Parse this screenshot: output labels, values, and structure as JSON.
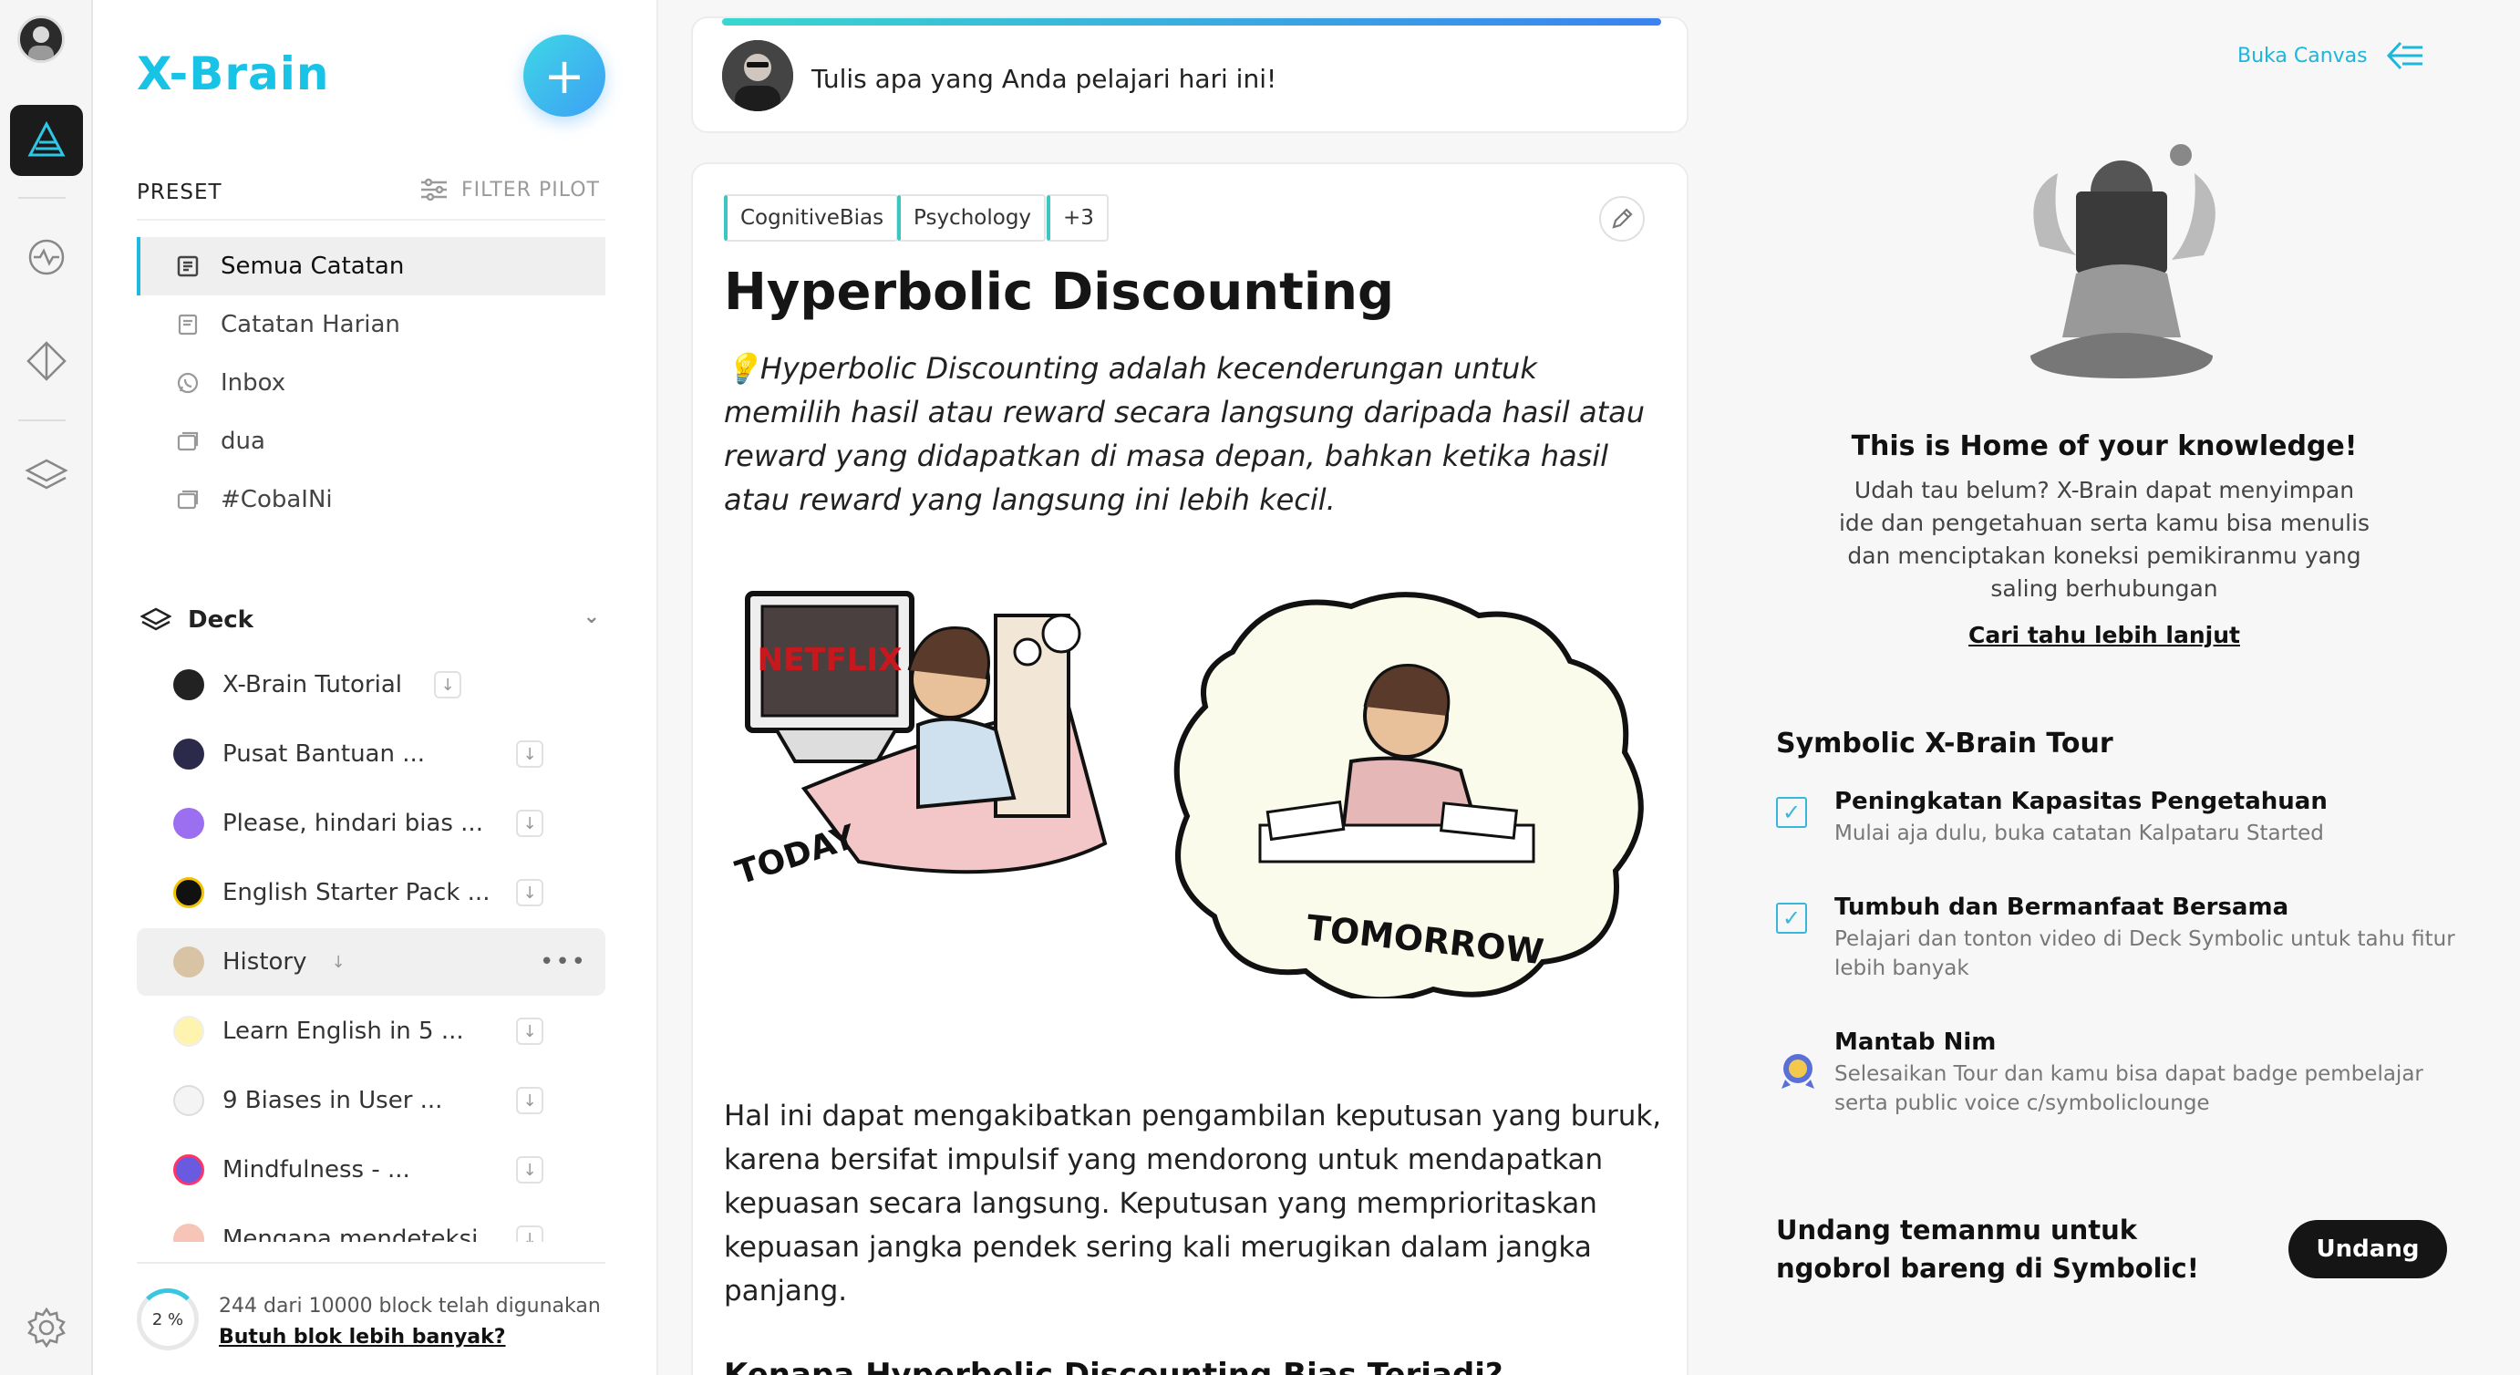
{
  "app": {
    "brand": "X-Brain"
  },
  "sidebar": {
    "preset_label": "PRESET",
    "filter_pilot": "FILTER PILOT",
    "nav": [
      {
        "label": "Semua Catatan",
        "icon": "notes-icon"
      },
      {
        "label": "Catatan Harian",
        "icon": "daily-notes-icon"
      },
      {
        "label": "Inbox",
        "icon": "whatsapp-icon"
      },
      {
        "label": "dua",
        "icon": "folder-icon"
      },
      {
        "label": "#CobaINi",
        "icon": "folder-icon"
      }
    ],
    "deck_label": "Deck",
    "decks": [
      {
        "label": "X-Brain Tutorial"
      },
      {
        "label": "Pusat Bantuan ..."
      },
      {
        "label": "Please, hindari bias ..."
      },
      {
        "label": "English Starter Pack ..."
      },
      {
        "label": "History"
      },
      {
        "label": "Learn English in 5 ..."
      },
      {
        "label": "9 Biases in User ..."
      },
      {
        "label": "Mindfulness - ..."
      },
      {
        "label": "Mengapa mendeteksi ..."
      }
    ],
    "usage": {
      "percent_label": "2 %",
      "percent": 2,
      "text": "244 dari 10000 block telah digunakan",
      "link": "Butuh blok lebih banyak?"
    }
  },
  "composer": {
    "placeholder": "Tulis apa yang Anda pelajari hari ini!"
  },
  "note": {
    "tags": [
      "CognitiveBias",
      "Psychology",
      "+3"
    ],
    "title": "Hyperbolic Discounting",
    "quote_emoji": "💡",
    "quote": "Hyperbolic Discounting adalah kecenderungan untuk memilih hasil atau reward secara langsung daripada hasil atau reward yang didapatkan di masa depan, bahkan ketika hasil atau reward yang langsung ini lebih kecil.",
    "illustration": {
      "tv_text": "NETFLIX",
      "left_caption": "TODAY",
      "right_caption": "TOMORROW"
    },
    "body": "Hal ini dapat mengakibatkan pengambilan keputusan yang buruk, karena bersifat impulsif yang mendorong untuk mendapatkan kepuasan secara langsung. Keputusan yang memprioritaskan kepuasan jangka pendek sering kali merugikan dalam jangka panjang.",
    "next_heading": "Kenapa Hyperbolic Discounting Bias Terjadi?"
  },
  "right": {
    "open_canvas": "Buka Canvas",
    "home_title": "This is Home of your knowledge!",
    "home_desc": "Udah tau belum? X-Brain dapat menyimpan ide dan pengetahuan serta kamu bisa menulis dan menciptakan koneksi pemikiranmu yang saling berhubungan",
    "home_link": "Cari tahu lebih lanjut",
    "tour_title": "Symbolic X-Brain Tour",
    "tour": [
      {
        "name": "Peningkatan Kapasitas Pengetahuan",
        "desc": "Mulai aja dulu, buka catatan Kalpataru Started",
        "done": true
      },
      {
        "name": "Tumbuh dan Bermanfaat Bersama",
        "desc": "Pelajari dan tonton video di Deck Symbolic untuk tahu fitur lebih banyak",
        "done": true
      },
      {
        "name": "Mantab Nim",
        "desc": "Selesaikan Tour dan kamu bisa dapat badge pembelajar serta public voice c/symboliclounge",
        "done": false
      }
    ],
    "invite_text": "Undang temanmu untuk ngobrol bareng di Symbolic!",
    "invite_button": "Undang"
  },
  "colors": {
    "accent": "#19c3e6",
    "active_rail": "#1b1b1b",
    "dark_button": "#151515"
  }
}
